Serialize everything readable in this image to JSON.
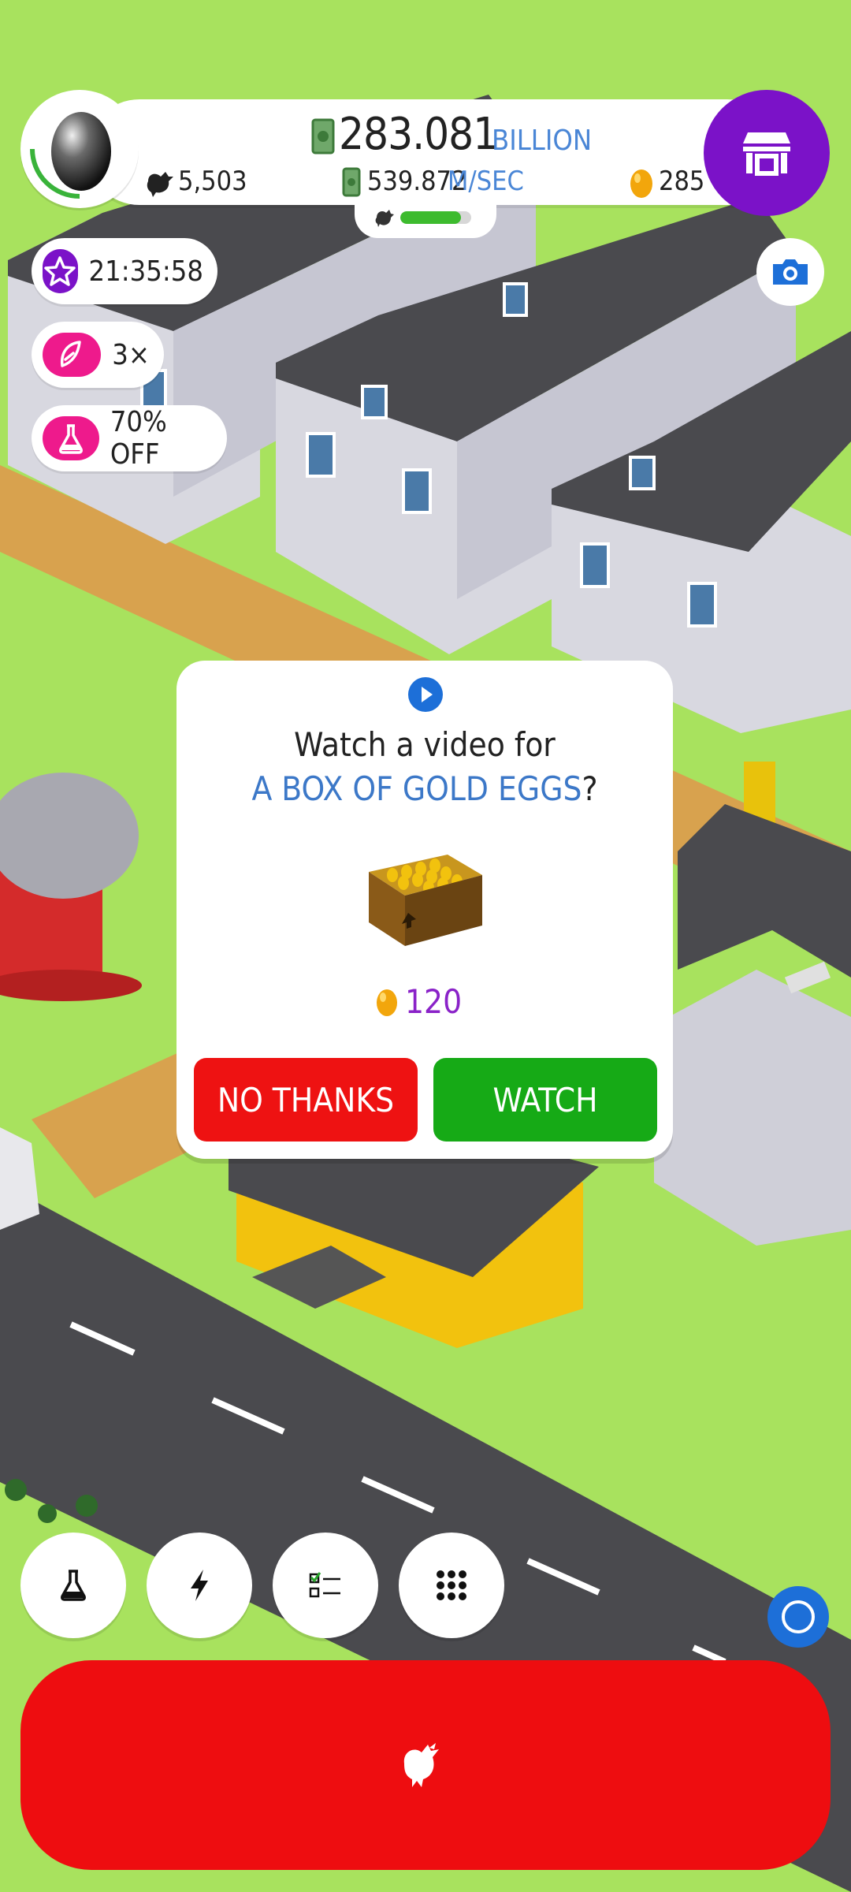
{
  "hud": {
    "money_value": "283.081",
    "money_unit": "BILLION",
    "chicken_count": "5,503",
    "rate_value": "539.872",
    "rate_unit": "M/SEC",
    "gold_eggs": "285",
    "progress_fraction": 0.85
  },
  "perks": [
    {
      "name": "boost-timer",
      "icon": "star-icon",
      "text": "21:35:58",
      "color": "#7b12c8"
    },
    {
      "name": "multiplier",
      "icon": "feather-icon",
      "text": "3×",
      "color": "#ee1a8c"
    },
    {
      "name": "research-discount",
      "icon": "flask-icon",
      "text": "70% OFF",
      "color": "#ee1a8c"
    }
  ],
  "dialog": {
    "line1": "Watch a video for",
    "highlight": "A BOX OF GOLD EGGS",
    "suffix": "?",
    "reward_amount": "120",
    "no_thanks_label": "NO THANKS",
    "watch_label": "WATCH"
  },
  "bottom_buttons": [
    "research-icon",
    "boost-icon",
    "tasks-icon",
    "menu-grid-icon"
  ],
  "colors": {
    "grass": "#a8e25e",
    "shop": "#7b12c8",
    "hatch": "#ee0d10",
    "no_thanks": "#ee1212",
    "watch": "#16aa16",
    "accent_blue": "#3c78c8"
  }
}
